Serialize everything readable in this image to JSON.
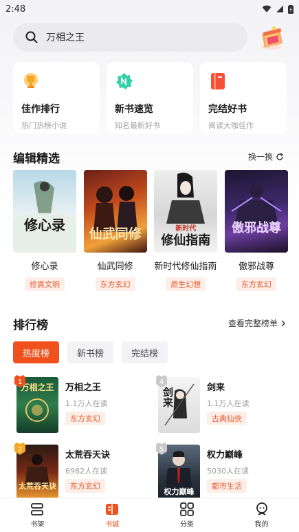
{
  "status": {
    "time": "2:48"
  },
  "search": {
    "query": "万相之王"
  },
  "feature_cards": [
    {
      "title": "佳作排行",
      "subtitle": "热门热榜小说",
      "icon": "trophy-icon"
    },
    {
      "title": "新书速览",
      "subtitle": "知名最新好书",
      "icon": "new-badge-icon"
    },
    {
      "title": "完结好书",
      "subtitle": "阅读大咖佳作",
      "icon": "book-icon"
    }
  ],
  "editor_picks": {
    "title": "编辑精选",
    "action": "换一换",
    "books": [
      {
        "title": "修心录",
        "tag": "修真文明",
        "cover_text": "修心录"
      },
      {
        "title": "仙武同修",
        "tag": "东方玄幻",
        "cover_text": "仙武同修"
      },
      {
        "title": "新时代修仙指南",
        "tag": "原生幻想",
        "cover_text": "修仙指南",
        "cover_text_top": "新时代"
      },
      {
        "title": "傲邪战尊",
        "tag": "东方玄幻",
        "cover_text": "傲邪战尊"
      }
    ]
  },
  "ranking": {
    "title": "排行榜",
    "action": "查看完整榜单",
    "tabs": [
      "热度榜",
      "新书榜",
      "完结榜"
    ],
    "items": [
      {
        "rank": "1",
        "title": "万相之王",
        "readers": "1.1万人在读",
        "tag": "东方玄幻",
        "cover_text": "万相之王"
      },
      {
        "rank": "4",
        "title": "剑来",
        "readers": "1.1万人在读",
        "tag": "古典仙侠",
        "cover_text": "剑来"
      },
      {
        "rank": "2",
        "title": "太荒吞天诀",
        "readers": "6982人在读",
        "tag": "东方玄幻",
        "cover_text": "太荒吞天诀"
      },
      {
        "rank": "5",
        "title": "权力巅峰",
        "readers": "5030人在读",
        "tag": "都市生活",
        "cover_text": "权力巅峰"
      }
    ]
  },
  "bottom_nav": [
    {
      "label": "书架",
      "icon": "bookshelf-icon"
    },
    {
      "label": "书城",
      "icon": "bookstore-icon",
      "active": true
    },
    {
      "label": "分类",
      "icon": "category-icon"
    },
    {
      "label": "我的",
      "icon": "profile-icon"
    }
  ],
  "colors": {
    "accent": "#f0501c",
    "tag_text": "#e85a2e",
    "tag_bg": "#fdeee8"
  }
}
